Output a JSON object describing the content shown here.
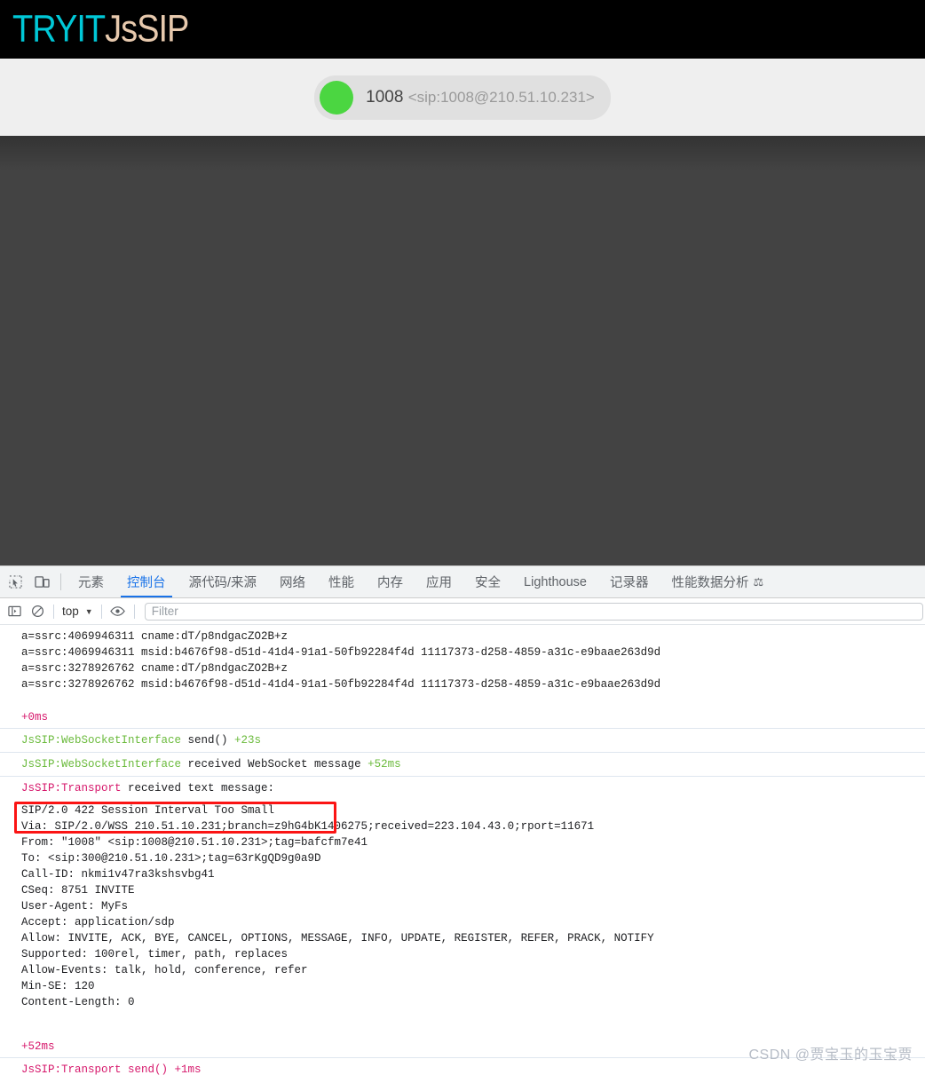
{
  "app": {
    "logo_primary": "TRYIT",
    "logo_secondary": "JsSIP",
    "status": {
      "dot_color": "#4bd641",
      "user": "1008",
      "uri": "<sip:1008@210.51.10.231>"
    }
  },
  "devtools": {
    "tabs": [
      {
        "label": "元素",
        "active": false
      },
      {
        "label": "控制台",
        "active": true
      },
      {
        "label": "源代码/来源",
        "active": false
      },
      {
        "label": "网络",
        "active": false
      },
      {
        "label": "性能",
        "active": false
      },
      {
        "label": "内存",
        "active": false
      },
      {
        "label": "应用",
        "active": false
      },
      {
        "label": "安全",
        "active": false
      },
      {
        "label": "Lighthouse",
        "active": false
      },
      {
        "label": "记录器",
        "active": false
      },
      {
        "label": "性能数据分析",
        "active": false,
        "icon": "flask-icon"
      }
    ],
    "toolbar": {
      "sidebar_icon": "sidebar-toggle-icon",
      "clear_icon": "clear-console-icon",
      "context_value": "top",
      "caret": "▼",
      "eye_icon": "eye-icon",
      "filter_placeholder": "Filter"
    }
  },
  "console": {
    "sdp_lines": [
      "a=ssrc:4069946311 cname:dT/p8ndgacZO2B+z",
      "a=ssrc:4069946311 msid:b4676f98-d51d-41d4-91a1-50fb92284f4d 11117373-d258-4859-a31c-e9baae263d9d",
      "a=ssrc:3278926762 cname:dT/p8ndgacZO2B+z",
      "a=ssrc:3278926762 msid:b4676f98-d51d-41d4-91a1-50fb92284f4d 11117373-d258-4859-a31c-e9baae263d9d"
    ],
    "timing_first": "+0ms",
    "entries": [
      {
        "label": "JsSIP:WebSocketInterface",
        "label_color": "green",
        "text": " send()",
        "timing": " +23s",
        "timing_color": "green"
      },
      {
        "label": "JsSIP:WebSocketInterface",
        "label_color": "green",
        "text": " received WebSocket message",
        "timing": " +52ms",
        "timing_color": "green"
      },
      {
        "label": "JsSIP:Transport",
        "label_color": "crimson",
        "text": " received text message:",
        "timing": "",
        "timing_color": "crimson"
      }
    ],
    "sip_message": {
      "status_line": "SIP/2.0 422 Session Interval Too Small",
      "headers": [
        "Via: SIP/2.0/WSS 210.51.10.231;branch=z9hG4bK1406275;received=223.104.43.0;rport=11671",
        "From: \"1008\" <sip:1008@210.51.10.231>;tag=bafcfm7e41",
        "To: <sip:300@210.51.10.231>;tag=63rKgQD9g0a9D",
        "Call-ID: nkmi1v47ra3kshsvbg41",
        "CSeq: 8751 INVITE",
        "User-Agent: MyFs",
        "Accept: application/sdp",
        "Allow: INVITE, ACK, BYE, CANCEL, OPTIONS, MESSAGE, INFO, UPDATE, REGISTER, REFER, PRACK, NOTIFY",
        "Supported: 100rel, timer, path, replaces",
        "Allow-Events: talk, hold, conference, refer",
        "Min-SE: 120",
        "Content-Length: 0"
      ]
    },
    "timing_second": "+52ms",
    "last_entry": {
      "label": "JsSIP:Transport",
      "text": " send()",
      "timing": " +1ms"
    },
    "highlight_color": "#fb1414"
  },
  "watermark": "CSDN @贾宝玉的玉宝贾"
}
